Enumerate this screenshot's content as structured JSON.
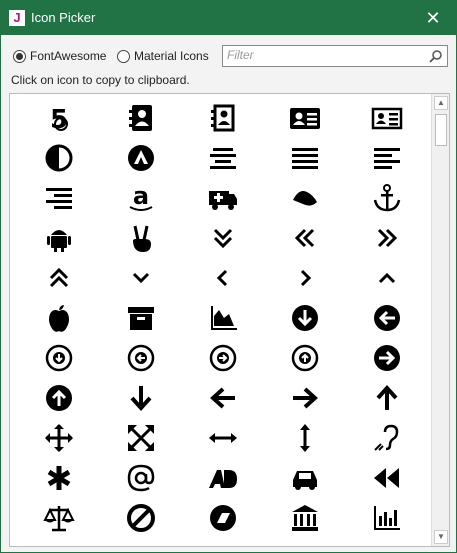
{
  "window": {
    "title": "Icon Picker",
    "app_badge": "J",
    "close_symbol": "✕"
  },
  "options": {
    "font_awesome_label": "FontAwesome",
    "material_icons_label": "Material Icons",
    "selected": "FontAwesome",
    "filter_placeholder": "Filter",
    "filter_value": ""
  },
  "hint_text": "Click on icon to copy to clipboard.",
  "icons": [
    "500px",
    "address-book",
    "address-book-o",
    "address-card",
    "address-card-o",
    "adjust",
    "adn",
    "align-center",
    "align-justify",
    "align-left",
    "align-right",
    "amazon",
    "ambulance",
    "american-sign-language-interpreting",
    "anchor",
    "android",
    "angellist",
    "angle-double-down",
    "angle-double-left",
    "angle-double-right",
    "angle-double-up",
    "angle-down",
    "angle-left",
    "angle-right",
    "angle-up",
    "apple",
    "archive",
    "area-chart",
    "arrow-circle-down",
    "arrow-circle-left",
    "arrow-circle-o-down",
    "arrow-circle-o-left",
    "arrow-circle-o-right",
    "arrow-circle-o-up",
    "arrow-circle-right",
    "arrow-circle-up",
    "arrow-down",
    "arrow-left",
    "arrow-right",
    "arrow-up",
    "arrows",
    "arrows-alt",
    "arrows-h",
    "arrows-v",
    "assistive-listening-systems",
    "asterisk",
    "at",
    "audio-description",
    "automobile",
    "backward",
    "balance-scale",
    "ban",
    "bandcamp",
    "bank",
    "bar-chart"
  ],
  "colors": {
    "titlebar": "#217346",
    "icon": "#000000"
  }
}
